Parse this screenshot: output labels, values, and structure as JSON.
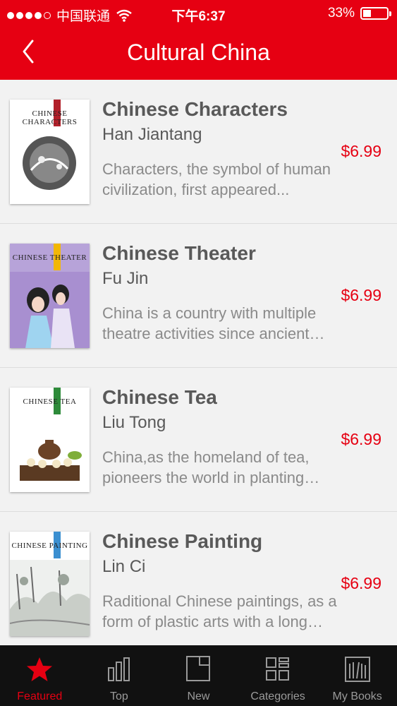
{
  "status_bar": {
    "carrier": "中国联通",
    "time": "下午6:37",
    "battery": "33%",
    "battery_level": 0.33
  },
  "header": {
    "title": "Cultural China"
  },
  "books": [
    {
      "title": "Chinese Characters",
      "author": "Han Jiantang",
      "description": "Characters, the symbol of human civilization, first appeared...",
      "price": "$6.99",
      "cover_title": "CHINESE CHARACTERS",
      "cover_color": "#b2202a"
    },
    {
      "title": "Chinese Theater",
      "author": "Fu Jin",
      "description": "China is a country with multiple theatre activities since ancient times...",
      "price": "$6.99",
      "cover_title": "CHINESE THEATER",
      "cover_color": "#f2b705"
    },
    {
      "title": "Chinese Tea",
      "author": "Liu Tong",
      "description": "China,as the homeland of tea, pioneers the world in planting tea...",
      "price": "$6.99",
      "cover_title": "CHINESE TEA",
      "cover_color": "#2e8b3a"
    },
    {
      "title": "Chinese Painting",
      "author": "Lin Ci",
      "description": "Raditional Chinese paintings, as a form of plastic arts with a long history...",
      "price": "$6.99",
      "cover_title": "CHINESE PAINTING",
      "cover_color": "#3b8fd0"
    }
  ],
  "tabs": [
    {
      "label": "Featured",
      "icon": "star-icon",
      "active": true
    },
    {
      "label": "Top",
      "icon": "bar-chart-icon",
      "active": false
    },
    {
      "label": "New",
      "icon": "new-book-icon",
      "active": false
    },
    {
      "label": "Categories",
      "icon": "categories-grid-icon",
      "active": false
    },
    {
      "label": "My Books",
      "icon": "bookshelf-icon",
      "active": false
    }
  ],
  "colors": {
    "accent": "#e60012",
    "tab_bar": "#111111",
    "price": "#e60012"
  }
}
